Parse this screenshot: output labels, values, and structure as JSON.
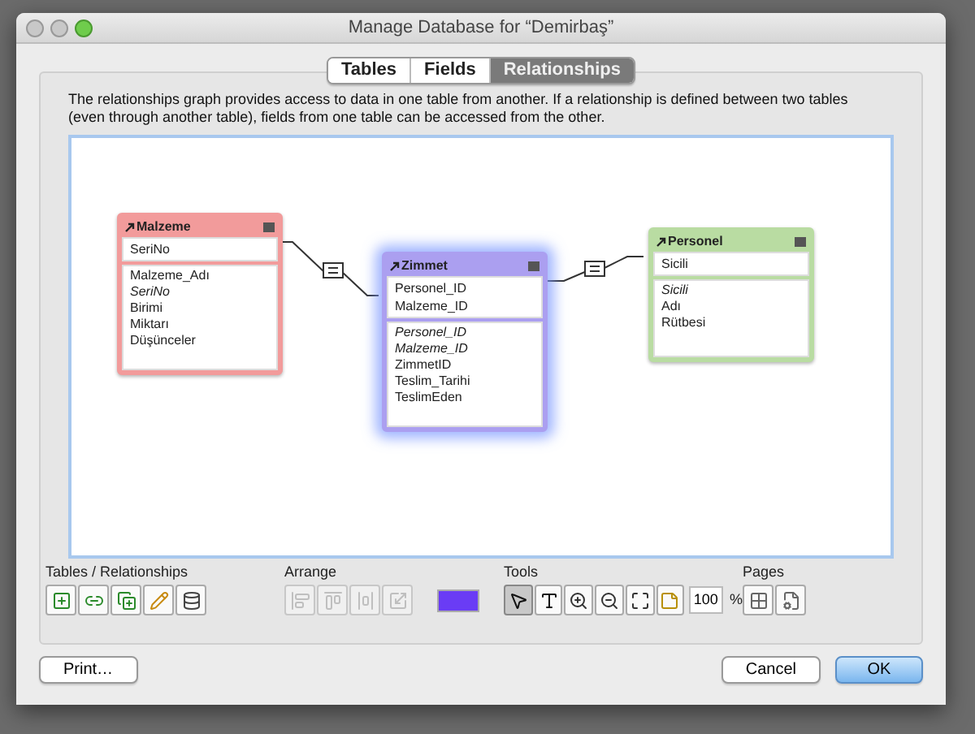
{
  "window": {
    "title": "Manage Database for “Demirbaş”"
  },
  "tabs": [
    {
      "label": "Tables",
      "selected": false
    },
    {
      "label": "Fields",
      "selected": false
    },
    {
      "label": "Relationships",
      "selected": true
    }
  ],
  "description": "The relationships graph provides access to data in one table from another. If a relationship is defined between two tables (even through another table), fields from one table can be accessed from the other.",
  "tables": [
    {
      "name": "Malzeme",
      "color": "#f29b9b",
      "selected": false,
      "match_fields": [
        "SeriNo"
      ],
      "fields": [
        {
          "name": "Malzeme_Adı",
          "italic": false
        },
        {
          "name": "SeriNo",
          "italic": true
        },
        {
          "name": "Birimi",
          "italic": false
        },
        {
          "name": "Miktarı",
          "italic": false
        },
        {
          "name": "Düşünceler",
          "italic": false
        }
      ]
    },
    {
      "name": "Zimmet",
      "color": "#ab9ff0",
      "selected": true,
      "match_fields": [
        "Personel_ID",
        "Malzeme_ID"
      ],
      "fields": [
        {
          "name": "Personel_ID",
          "italic": true
        },
        {
          "name": "Malzeme_ID",
          "italic": true
        },
        {
          "name": "ZimmetID",
          "italic": false
        },
        {
          "name": "Teslim_Tarihi",
          "italic": false
        },
        {
          "name": "TeslimEden",
          "italic": false
        }
      ]
    },
    {
      "name": "Personel",
      "color": "#b9dca2",
      "selected": false,
      "match_fields": [
        "Sicili"
      ],
      "fields": [
        {
          "name": "Sicili",
          "italic": true
        },
        {
          "name": "Adı",
          "italic": false
        },
        {
          "name": "Rütbesi",
          "italic": false
        }
      ]
    }
  ],
  "toolbar": {
    "groups": [
      {
        "label": "Tables / Relationships",
        "kind": "buttons",
        "buttons": [
          {
            "disabled": false,
            "selected": false
          },
          {
            "disabled": false,
            "selected": false
          },
          {
            "disabled": false,
            "selected": false
          },
          {
            "disabled": false,
            "selected": false
          },
          {
            "disabled": false,
            "selected": false
          }
        ]
      },
      {
        "label": "Arrange",
        "kind": "arrange",
        "buttons": [
          {
            "disabled": true,
            "selected": false
          },
          {
            "disabled": true,
            "selected": false
          },
          {
            "disabled": true,
            "selected": false
          },
          {
            "disabled": true,
            "selected": false
          }
        ]
      },
      {
        "label": "Tools",
        "kind": "tools",
        "buttons": [
          {
            "disabled": false,
            "selected": true
          },
          {
            "disabled": false,
            "selected": false
          },
          {
            "disabled": false,
            "selected": false
          },
          {
            "disabled": false,
            "selected": false
          },
          {
            "disabled": false,
            "selected": false
          },
          {
            "disabled": false,
            "selected": false
          }
        ],
        "zoom": "100",
        "unit": "%"
      },
      {
        "label": "Pages",
        "kind": "buttons",
        "buttons": [
          {
            "disabled": false,
            "selected": false
          },
          {
            "disabled": false,
            "selected": false
          }
        ]
      }
    ]
  },
  "buttons": [
    {
      "label": "Print…",
      "kind": "normal"
    },
    {
      "label": "Cancel",
      "kind": "normal"
    },
    {
      "label": "OK",
      "kind": "default"
    }
  ]
}
